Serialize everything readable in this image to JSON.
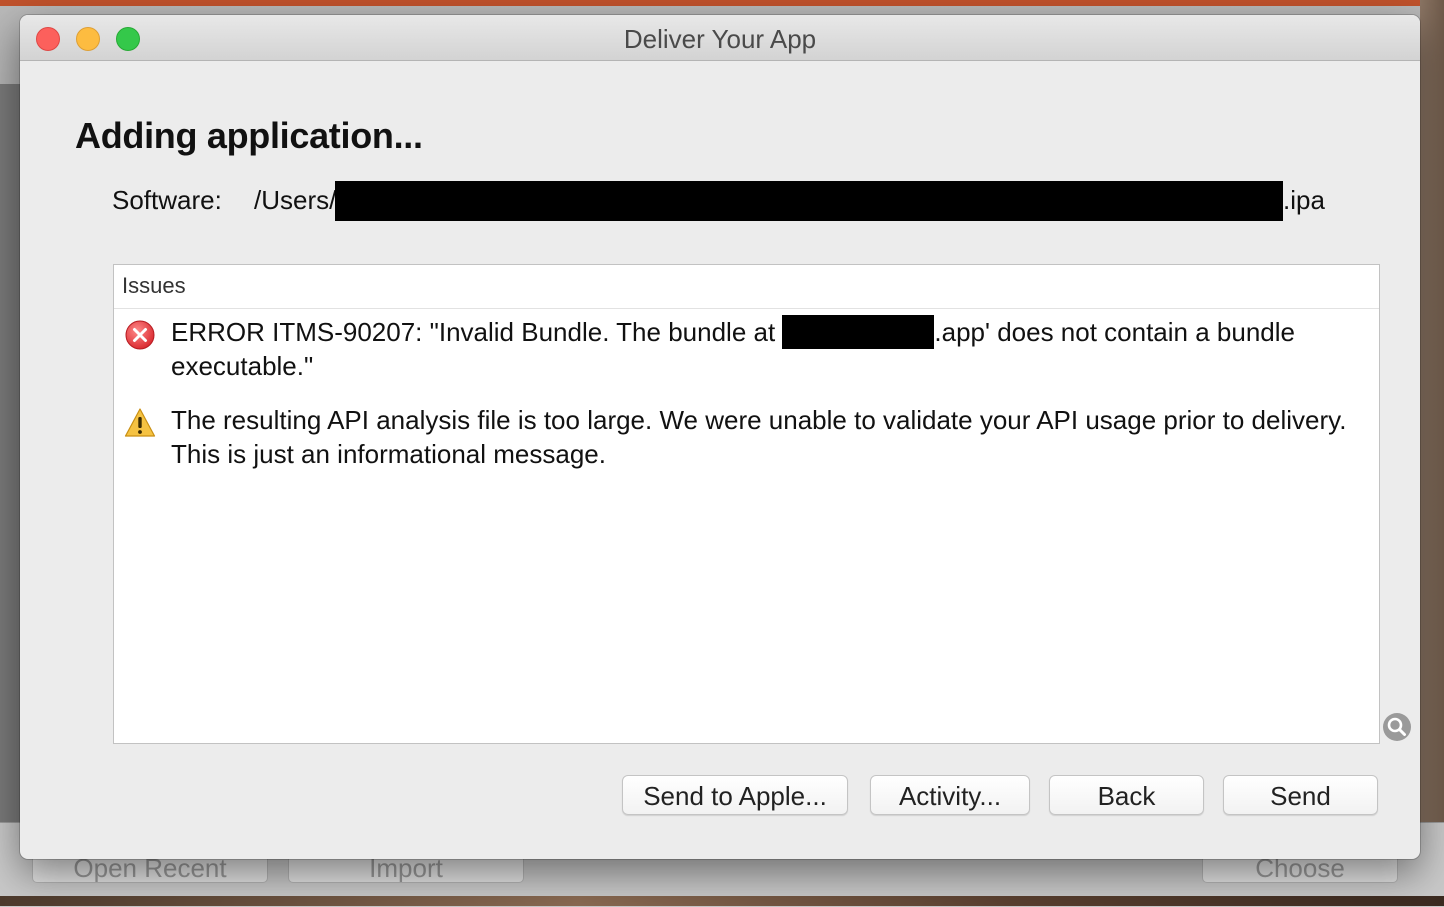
{
  "window": {
    "title": "Deliver Your App"
  },
  "heading": "Adding application...",
  "software": {
    "label": "Software:",
    "path_prefix": "/Users/",
    "path_suffix": ".ipa"
  },
  "issues": {
    "header": "Issues",
    "items": [
      {
        "type": "error",
        "icon": "error-x-icon",
        "text_before": "ERROR ITMS-90207: \"Invalid Bundle. The bundle at ",
        "text_after": ".app' does not contain a bundle executable.\""
      },
      {
        "type": "warning",
        "icon": "warning-triangle-icon",
        "text": "The resulting API analysis file is too large.  We were unable to validate your API usage prior to delivery.  This is just an informational message."
      }
    ]
  },
  "buttons": {
    "send_to_apple": "Send to Apple...",
    "activity": "Activity...",
    "back": "Back",
    "send": "Send"
  },
  "background_window": {
    "open_recent": "Open Recent",
    "import": "Import",
    "choose": "Choose"
  },
  "colors": {
    "error_red": "#e5484d",
    "warning_yellow": "#f5c242",
    "close": "#fc605c",
    "minimize": "#fdbc40",
    "maximize": "#34c84a"
  }
}
